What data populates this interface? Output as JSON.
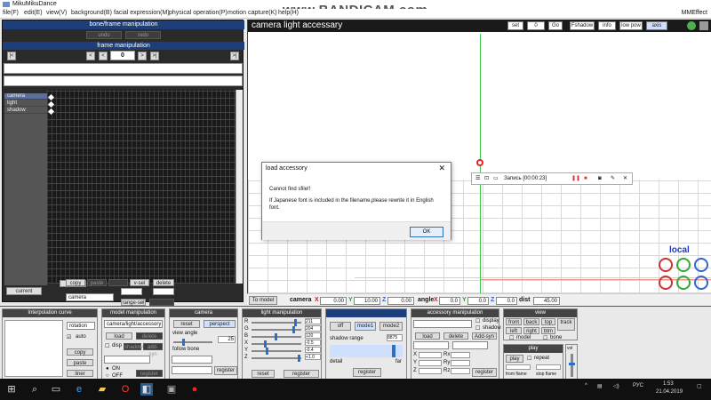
{
  "app": {
    "title": "MikuMikuDance",
    "watermark": "www.BANDICAM.com",
    "mmeffect": "MMEffect"
  },
  "menu": [
    "file(F)",
    "edit(E)",
    "view(V)",
    "background(B)",
    "facial expression(M)",
    "physical operation(P)",
    "motion capture(K)",
    "help(H)"
  ],
  "timeline": {
    "header": "bone/frame manipulation",
    "undo": "undo",
    "redo": "redo",
    "frame_manip_label": "frame manipulation",
    "frame_value": "0",
    "tracks": [
      "camera",
      "light",
      "shadow"
    ],
    "current_label": "current",
    "copy": "copy",
    "paste": "paste",
    "delete": "delete",
    "vsel": "v-sel",
    "range_sel": "range-sel",
    "camera_select": "camera"
  },
  "viewport": {
    "title": "camera light accessary",
    "set": "set",
    "frame_input": "0",
    "go": "Go",
    "fshadow": "Fshadow",
    "info": "info",
    "lowpow": "low pow",
    "axis": "axis",
    "local": "local",
    "to_model": "To model",
    "camera_label": "camera",
    "cam_x": "0.00",
    "cam_y": "10.00",
    "cam_z": "0.00",
    "angle_label": "angle",
    "ang_x": "0.0",
    "ang_y": "0.0",
    "ang_z": "0.0",
    "dist_label": "dist",
    "dist": "45.00"
  },
  "dialog": {
    "title": "load accessory",
    "line1": "Cannot find sfile!!",
    "line2": "If Japanese font is included in the filename,please rewrite it in English font.",
    "ok": "OK"
  },
  "recorder": {
    "text": "Запись [00:00:23]"
  },
  "panels": {
    "interp": {
      "header": "Interpolation curve",
      "rotation": "rotation",
      "auto": "auto",
      "copy": "copy",
      "paste": "paste",
      "liner": "liner"
    },
    "model": {
      "header": "model manipulation",
      "select": "camera/light/accessory",
      "load": "load",
      "delete": "delete",
      "disp": "disp",
      "shadow": "shadow",
      "add_syn": "add-syn",
      "register": "register",
      "on": "ON",
      "off": "OFF"
    },
    "camera": {
      "header": "camera",
      "reset": "reset",
      "perspect": "perspect",
      "view_angle": "view angle",
      "view_angle_val": "25",
      "follow_bone": "follow bone",
      "register": "register"
    },
    "light": {
      "header": "light manipulation",
      "r": "R",
      "g": "G",
      "b": "B",
      "x": "X",
      "y": "Y",
      "z": "Z",
      "r_val": "211",
      "g_val": "204",
      "b_val": "120",
      "x_val": "-0.5",
      "y_val": "-0.4",
      "z_val": "+1.0",
      "reset": "reset",
      "register": "register"
    },
    "self_shadow": {
      "off": "off",
      "mode1": "mode1",
      "mode2": "mode2",
      "shadow_range": "shadow range",
      "range_val": "8875",
      "detail": "detail",
      "far": "far",
      "register": "register"
    },
    "accessory": {
      "header": "accessory manipulation",
      "display": "display",
      "shadow": "shadow",
      "add_syn": "Add-syn",
      "load": "load",
      "delete": "delete",
      "x": "X",
      "y": "Y",
      "z": "Z",
      "rx": "Rx",
      "ry": "Ry",
      "rz": "Rz",
      "si": "Si",
      "tr": "Tr",
      "register": "register"
    },
    "view": {
      "header": "view",
      "front": "front",
      "back": "back",
      "top": "top",
      "track": "track",
      "left": "left",
      "right": "right",
      "btm": "btm",
      "model": "model",
      "bone": "bone",
      "play_header": "play",
      "play": "play",
      "repeat": "repeat",
      "from_frame": "from flame",
      "stop_frame": "stop flame",
      "vol": "vol"
    }
  },
  "taskbar": {
    "lang": "РУС",
    "time": "1:53",
    "date": "21.04.2019"
  },
  "colors": {
    "header_blue": "#1d3e78",
    "accent_red": "#e22222",
    "axis_green": "#3ec84a",
    "local_blue": "#2033c8"
  }
}
